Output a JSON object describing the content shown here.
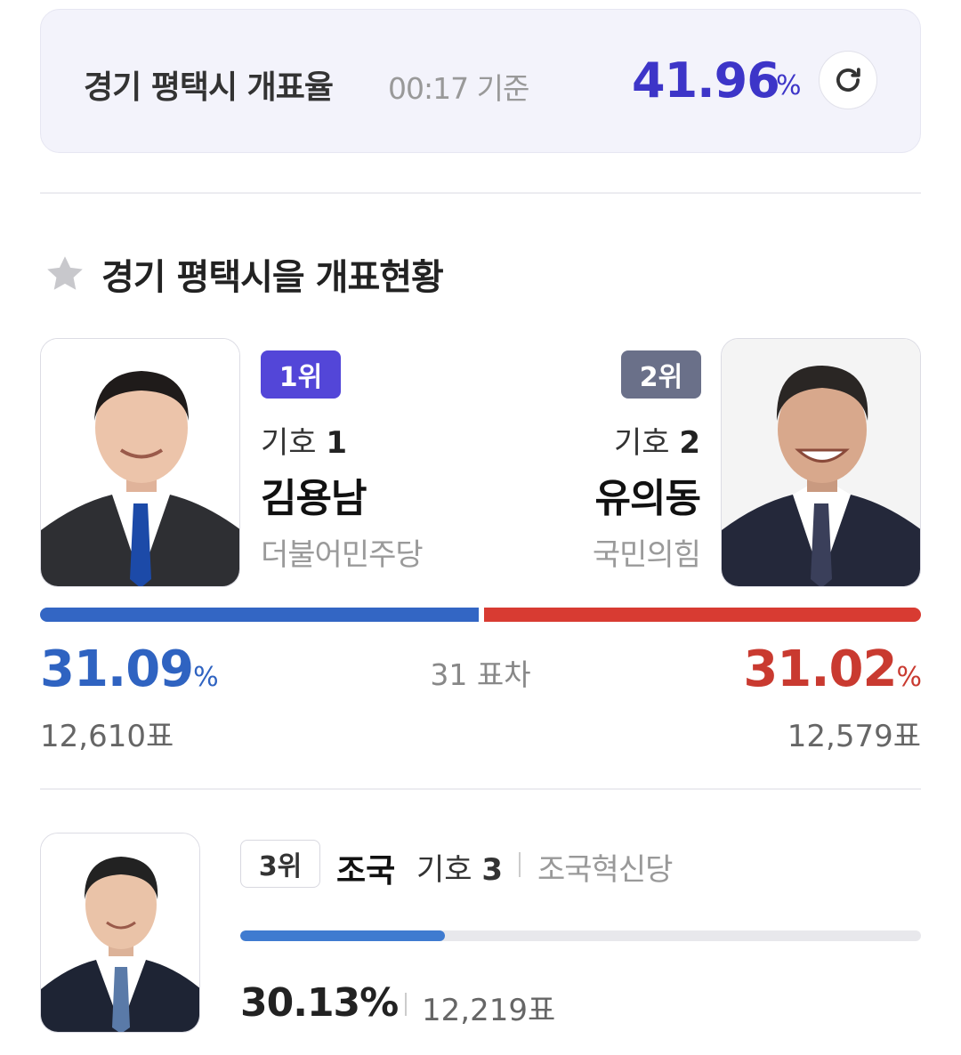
{
  "header": {
    "title": "경기 평택시 개표율",
    "time": "00:17 기준",
    "rate": "41.96",
    "rate_unit": "%",
    "refresh_icon": "refresh-icon"
  },
  "section": {
    "title": "경기 평택시을 개표현황",
    "star_icon": "star-icon"
  },
  "candidates": [
    {
      "rank": "1위",
      "number_label": "기호",
      "number": "1",
      "name": "김용남",
      "party": "더불어민주당",
      "percent": "31.09",
      "percent_unit": "%",
      "votes": "12,610표",
      "color": "#3366c4",
      "share": 31.09
    },
    {
      "rank": "2위",
      "number_label": "기호",
      "number": "2",
      "name": "유의동",
      "party": "국민의힘",
      "percent": "31.02",
      "percent_unit": "%",
      "votes": "12,579표",
      "color": "#d83b32",
      "share": 31.02
    },
    {
      "rank": "3위",
      "number_label": "기호",
      "number": "3",
      "name": "조국",
      "party": "조국혁신당",
      "percent": "30.13%",
      "votes": "12,219표",
      "color": "#3f7bd0",
      "share": 30.13
    }
  ],
  "difference": "31 표차"
}
